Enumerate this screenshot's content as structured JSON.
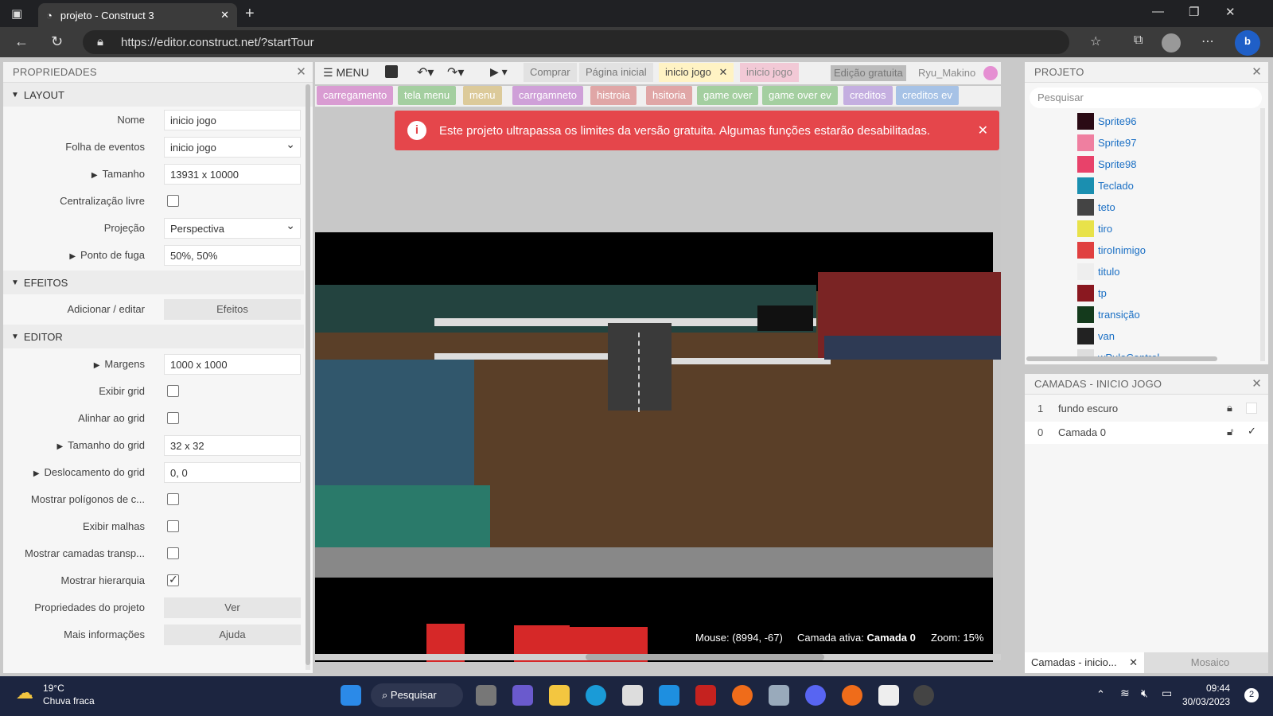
{
  "browser": {
    "tab_title": "projeto - Construct 3",
    "url": "https://editor.construct.net/?startTour"
  },
  "properties": {
    "title": "PROPRIEDADES",
    "sections": {
      "layout": "LAYOUT",
      "effects": "EFEITOS",
      "editor": "EDITOR"
    },
    "rows": {
      "nome": {
        "label": "Nome",
        "value": "inicio jogo"
      },
      "folha": {
        "label": "Folha de eventos",
        "value": "inicio jogo"
      },
      "tamanho": {
        "label": "Tamanho",
        "value": "13931 x 10000"
      },
      "central": {
        "label": "Centralização livre"
      },
      "projecao": {
        "label": "Projeção",
        "value": "Perspectiva"
      },
      "fuga": {
        "label": "Ponto de fuga",
        "value": "50%, 50%"
      },
      "efeitos": {
        "label": "Adicionar / editar",
        "value": "Efeitos"
      },
      "margens": {
        "label": "Margens",
        "value": "1000 x 1000"
      },
      "grid": {
        "label": "Exibir grid"
      },
      "alinhar": {
        "label": "Alinhar ao grid"
      },
      "tamgrid": {
        "label": "Tamanho do grid",
        "value": "32 x 32"
      },
      "desloc": {
        "label": "Deslocamento do grid",
        "value": "0, 0"
      },
      "poligonos": {
        "label": "Mostrar polígonos de c..."
      },
      "malhas": {
        "label": "Exibir malhas"
      },
      "transp": {
        "label": "Mostrar camadas transp..."
      },
      "hierarquia": {
        "label": "Mostrar hierarquia"
      },
      "projprops": {
        "label": "Propriedades do projeto",
        "value": "Ver"
      },
      "info": {
        "label": "Mais informações",
        "value": "Ajuda"
      }
    }
  },
  "toolbar": {
    "menu": "MENU",
    "buttons": [
      "Comprar",
      "Página inicial"
    ],
    "active_tab": "inicio jogo",
    "other_tab": "inicio jogo",
    "license": "Edição gratuita",
    "user": "Ryu_Makino"
  },
  "layout_tabs": [
    "carregamento",
    "tela menu",
    "menu",
    "carrgamneto",
    "histroia",
    "hsitoria",
    "game over",
    "game over ev",
    "creditos",
    "creditos ev"
  ],
  "banner": "Este projeto ultrapassa os limites da versão gratuita. Algumas funções estarão desabilitadas.",
  "status": {
    "mouse": "Mouse: (8994, -67)",
    "layer_label": "Camada ativa:",
    "layer_value": "Camada 0",
    "zoom": "Zoom: 15%"
  },
  "project": {
    "title": "PROJETO",
    "search_placeholder": "Pesquisar",
    "items": [
      {
        "name": "Sprite96",
        "color": "#2a0a14"
      },
      {
        "name": "Sprite97",
        "color": "#ef7fa0"
      },
      {
        "name": "Sprite98",
        "color": "#e8426a"
      },
      {
        "name": "Teclado",
        "color": "#1b8fb0"
      },
      {
        "name": "teto",
        "color": "#444444"
      },
      {
        "name": "tiro",
        "color": "#e8e24a"
      },
      {
        "name": "tiroInimigo",
        "color": "#e04040"
      },
      {
        "name": "titulo",
        "color": "#eeeeee"
      },
      {
        "name": "tp",
        "color": "#8a1820"
      },
      {
        "name": "transição",
        "color": "#143a1c"
      },
      {
        "name": "van",
        "color": "#222222"
      },
      {
        "name": "wPuloControl",
        "color": "#dddddd"
      }
    ]
  },
  "layers": {
    "title": "CAMADAS - INICIO JOGO",
    "items": [
      {
        "index": "1",
        "name": "fundo escuro"
      },
      {
        "index": "0",
        "name": "Camada 0"
      }
    ],
    "tab_active": "Camadas - inicio...",
    "tab_other": "Mosaico"
  },
  "taskbar": {
    "weather_temp": "19°C",
    "weather_desc": "Chuva fraca",
    "search": "Pesquisar",
    "time": "09:44",
    "date": "30/03/2023",
    "notif": "2"
  }
}
